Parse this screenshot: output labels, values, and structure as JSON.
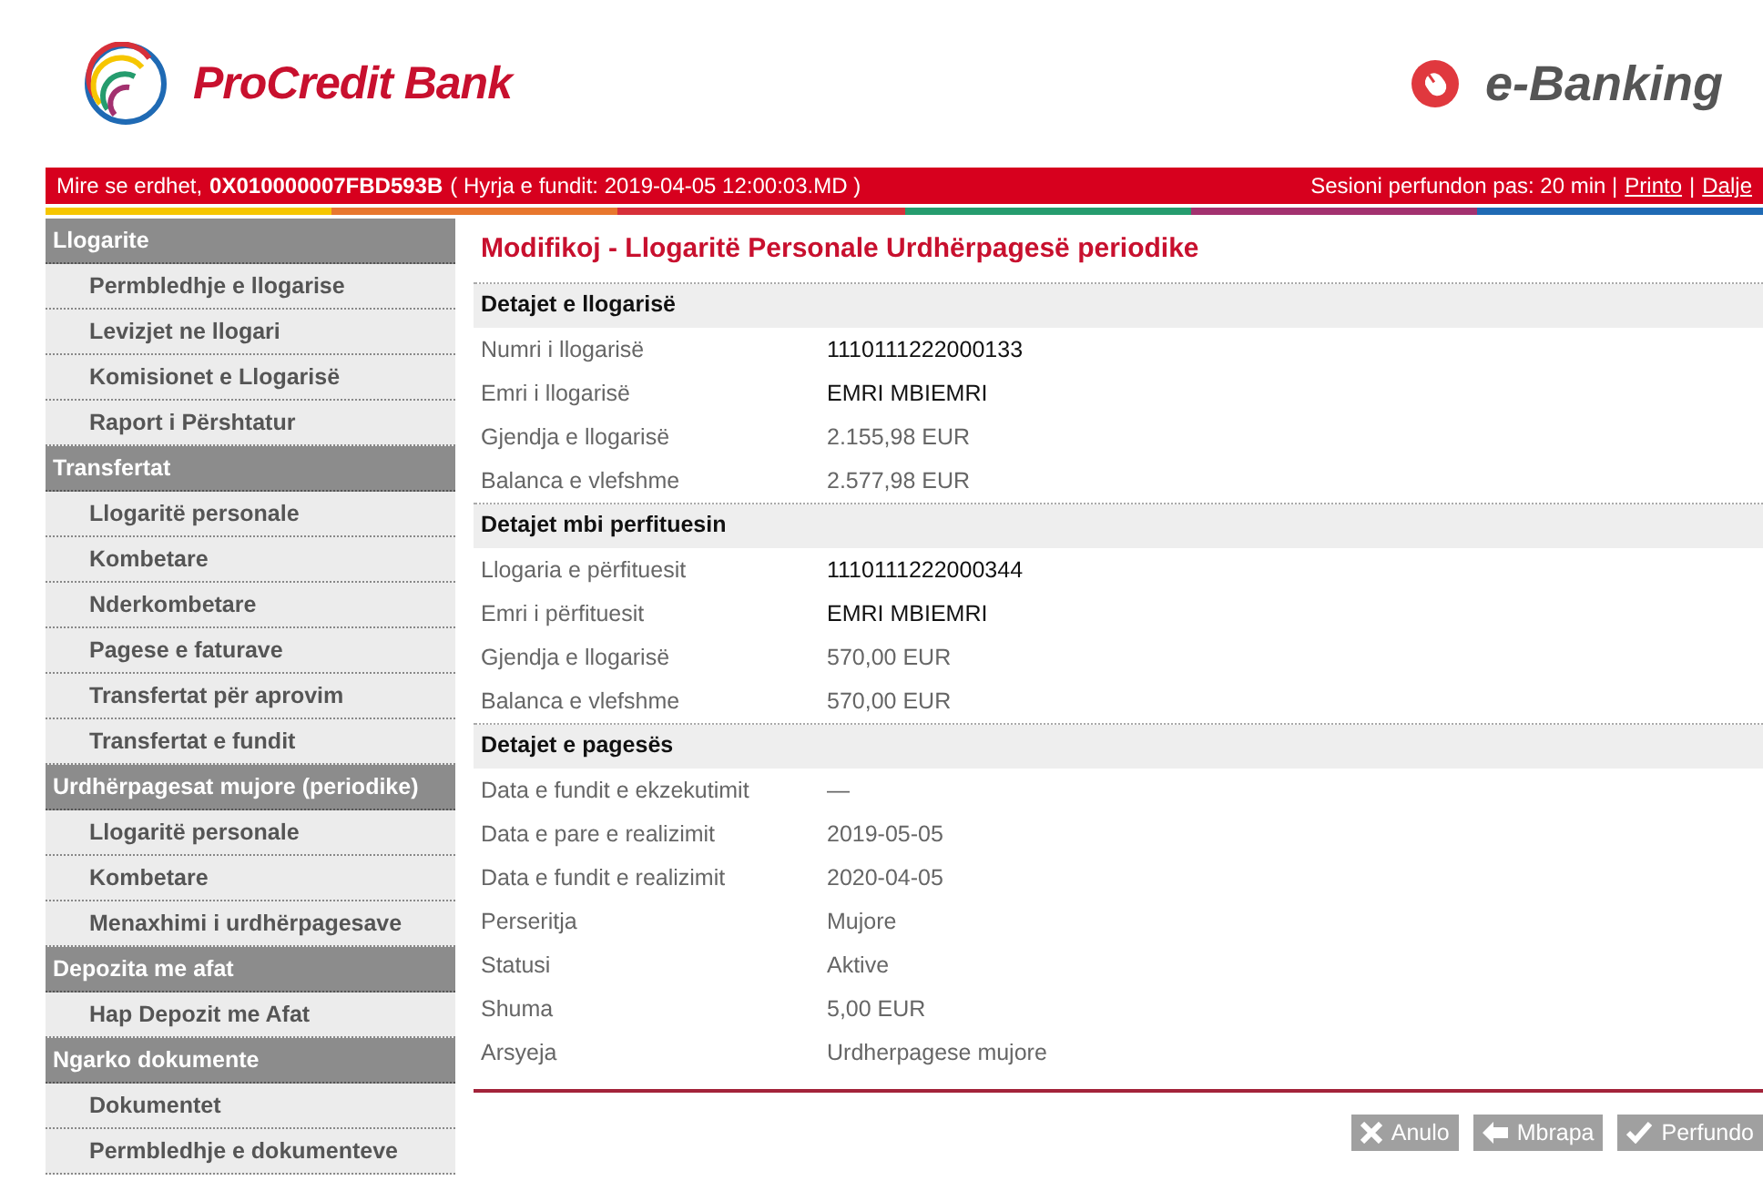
{
  "header": {
    "bank_name": "ProCredit Bank",
    "product_name": "e-Banking"
  },
  "top_bar": {
    "greeting": "Mire se erdhet,",
    "user_id": "0X010000007FBD593B",
    "last_login": "( Hyrja e fundit: 2019-04-05 12:00:03.MD )",
    "session": "Sesioni perfundon pas: 20 min |",
    "links": [
      "Printo",
      "Dalje"
    ],
    "separator": "|"
  },
  "sidebar": {
    "groups": [
      {
        "title": "Llogarite",
        "items": [
          "Permbledhje e llogarise",
          "Levizjet ne llogari",
          "Komisionet e Llogarisë",
          "Raport i Përshtatur"
        ]
      },
      {
        "title": "Transfertat",
        "items": [
          "Llogaritë personale",
          "Kombetare",
          "Nderkombetare",
          "Pagese e faturave",
          "Transfertat për aprovim",
          "Transfertat e fundit"
        ]
      },
      {
        "title": "Urdhërpagesat mujore (periodike)",
        "items": [
          "Llogaritë personale",
          "Kombetare",
          "Menaxhimi i urdhërpagesave"
        ]
      },
      {
        "title": "Depozita me afat",
        "items": [
          "Hap Depozit me Afat"
        ]
      },
      {
        "title": "Ngarko dokumente",
        "items": [
          "Dokumentet",
          "Permbledhje e dokumenteve"
        ]
      }
    ]
  },
  "page_title": "Modifikoj - Llogaritë Personale Urdhërpagesë periodike",
  "sections": [
    {
      "title": "Detajet e llogarisë",
      "rows": [
        {
          "label": "Numri i llogarisë",
          "value": "1110111222000133",
          "strong": true
        },
        {
          "label": "Emri i llogarisë",
          "value": "EMRI MBIEMRI",
          "strong": true
        },
        {
          "label": "Gjendja e llogarisë",
          "value": "2.155,98 EUR",
          "strong": false
        },
        {
          "label": "Balanca e vlefshme",
          "value": "2.577,98 EUR",
          "strong": false
        }
      ]
    },
    {
      "title": "Detajet mbi perfituesin",
      "rows": [
        {
          "label": "Llogaria e përfituesit",
          "value": "1110111222000344",
          "strong": true
        },
        {
          "label": "Emri i përfituesit",
          "value": "EMRI MBIEMRI",
          "strong": true
        },
        {
          "label": "Gjendja e llogarisë",
          "value": "570,00 EUR",
          "strong": false
        },
        {
          "label": "Balanca e vlefshme",
          "value": "570,00 EUR",
          "strong": false
        }
      ]
    },
    {
      "title": "Detajet e pagesës",
      "rows": [
        {
          "label": "Data e fundit e ekzekutimit",
          "value": "—",
          "strong": false
        },
        {
          "label": "Data e pare e realizimit",
          "value": "2019-05-05",
          "strong": false
        },
        {
          "label": "Data e fundit e realizimit",
          "value": "2020-04-05",
          "strong": false
        },
        {
          "label": "Perseritja",
          "value": "Mujore",
          "strong": false
        },
        {
          "label": "Statusi",
          "value": "Aktive",
          "strong": false
        },
        {
          "label": "Shuma",
          "value": "5,00 EUR",
          "strong": false
        },
        {
          "label": "Arsyeja",
          "value": "Urdherpagese mujore",
          "strong": false
        }
      ]
    }
  ],
  "buttons": [
    {
      "kind": "cancel",
      "label": "Anulo"
    },
    {
      "kind": "back",
      "label": "Mbrapa"
    },
    {
      "kind": "finish",
      "label": "Perfundo"
    }
  ]
}
